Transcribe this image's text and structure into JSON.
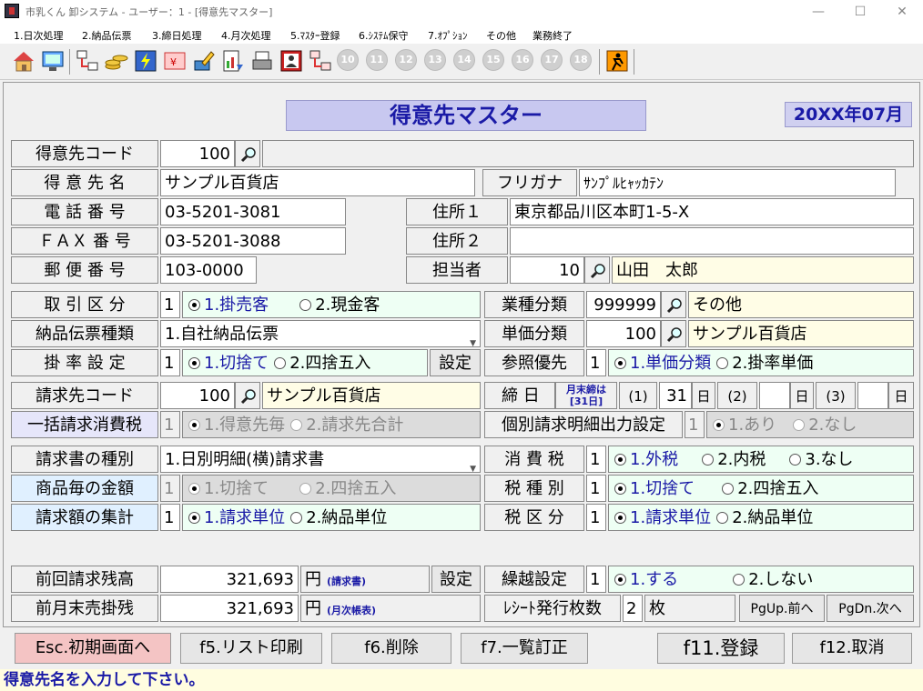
{
  "window": {
    "title": "市乳くん 卸システム - ユーザー：1 - [得意先マスター]"
  },
  "menu": [
    "1.日次処理",
    "2.納品伝票",
    "3.締日処理",
    "4.月次処理",
    "5.ﾏｽﾀｰ登録",
    "6.ｼｽﾃﾑ保守",
    "7.ｵﾌﾟｼｮﾝ",
    "その他",
    "業務終了"
  ],
  "toolbar": {
    "numbers": [
      "10",
      "11",
      "12",
      "13",
      "14",
      "15",
      "16",
      "17",
      "18"
    ]
  },
  "form": {
    "heading": "得意先マスター",
    "period": "20XX年07月",
    "code_label": "得意先コード",
    "code_value": "100",
    "name_label": "得 意 先 名",
    "name_value": "サンプル百貨店",
    "kana_label": "フリガナ",
    "kana_value": "ｻﾝﾌﾟﾙﾋｬｯｶﾃﾝ",
    "tel_label": "電 話 番 号",
    "tel_value": "03-5201-3081",
    "fax_label": "ＦＡＸ 番 号",
    "fax_value": "03-5201-3088",
    "zip_label": "郵 便 番 号",
    "zip_value": "103-0000",
    "addr1_label": "住所１",
    "addr1_value": "東京都品川区本町1-5-X",
    "addr2_label": "住所２",
    "addr2_value": "",
    "staff_label": "担当者",
    "staff_code": "10",
    "staff_name": "山田　太郎",
    "trade_label": "取 引 区 分",
    "trade_value": "1",
    "trade_opt1": "1.掛売客",
    "trade_opt2": "2.現金客",
    "slip_label": "納品伝票種類",
    "slip_value": "1.自社納品伝票",
    "rate_label": "掛 率 設 定",
    "rate_value": "1",
    "rate_opt1": "1.切捨て",
    "rate_opt2": "2.四捨五入",
    "rate_btn": "設定",
    "industry_label": "業種分類",
    "industry_code": "999999",
    "industry_name": "その他",
    "price_label": "単価分類",
    "price_code": "100",
    "price_name": "サンプル百貨店",
    "ref_label": "参照優先",
    "ref_value": "1",
    "ref_opt1": "1.単価分類",
    "ref_opt2": "2.掛率単価",
    "bill_label": "請求先コード",
    "bill_code": "100",
    "bill_name": "サンプル百貨店",
    "close_label": "締 日",
    "close_note1": "月末締は",
    "close_note2": "[31日]",
    "close_p1": "(1)",
    "close_d1": "31",
    "close_unit": "日",
    "close_p2": "(2)",
    "close_d2": "",
    "close_p3": "(3)",
    "close_d3": "",
    "bulk_label": "一括請求消費税",
    "bulk_value": "1",
    "bulk_opt1": "1.得意先毎",
    "bulk_opt2": "2.請求先合計",
    "indiv_label": "個別請求明細出力設定",
    "indiv_value": "1",
    "indiv_opt1": "1.あり",
    "indiv_opt2": "2.なし",
    "invtype_label": "請求書の種別",
    "invtype_value": "1.日別明細(横)請求書",
    "goods_label": "商品毎の金額",
    "goods_value": "1",
    "goods_opt1": "1.切捨て",
    "goods_opt2": "2.四捨五入",
    "sum_label": "請求額の集計",
    "sum_value": "1",
    "sum_opt1": "1.請求単位",
    "sum_opt2": "2.納品単位",
    "tax_label": "消 費 税",
    "tax_value": "1",
    "tax_opt1": "1.外税",
    "tax_opt2": "2.内税",
    "tax_opt3": "3.なし",
    "taxkind_label": "税 種 別",
    "taxkind_value": "1",
    "taxkind_opt1": "1.切捨て",
    "taxkind_opt2": "2.四捨五入",
    "taxdiv_label": "税 区 分",
    "taxdiv_value": "1",
    "taxdiv_opt1": "1.請求単位",
    "taxdiv_opt2": "2.納品単位",
    "prev_label": "前回請求残高",
    "prev_value": "321,693",
    "yen": "円",
    "prev_note": "(請求書)",
    "prev_btn": "設定",
    "carry_label": "繰越設定",
    "carry_value": "1",
    "carry_opt1": "1.する",
    "carry_opt2": "2.しない",
    "month_label": "前月末売掛残",
    "month_value": "321,693",
    "month_note": "(月次帳表)",
    "receipt_label": "ﾚｼｰﾄ発行枚数",
    "receipt_value": "2",
    "receipt_unit": "枚",
    "pgup": "PgUp.前へ",
    "pgdn": "PgDn.次へ"
  },
  "footer": {
    "esc": "Esc.初期画面へ",
    "f5": "f5.リスト印刷",
    "f6": "f6.削除",
    "f7": "f7.一覧訂正",
    "f11": "f11.登録",
    "f12": "f12.取消"
  },
  "status": "得意先名を入力して下さい。"
}
